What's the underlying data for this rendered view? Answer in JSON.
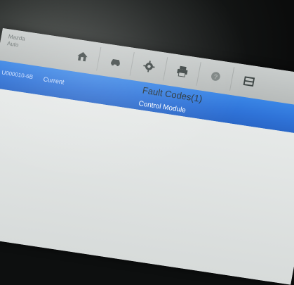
{
  "toolbar": {
    "brand_line1": "Mazda",
    "brand_line2": "Auto",
    "icons": [
      "home-icon",
      "vehicle-icon",
      "gear-icon",
      "printer-icon",
      "help-icon",
      "menu-icon"
    ]
  },
  "fault_list": {
    "title": "Fault Codes(1)",
    "rows": [
      {
        "code": "U000010-6B",
        "status": "Current",
        "description": "Control Module"
      }
    ]
  },
  "colors": {
    "selected_row": "#2f73d8",
    "toolbar": "#c2c6c5",
    "background": "#e6e9e8"
  }
}
